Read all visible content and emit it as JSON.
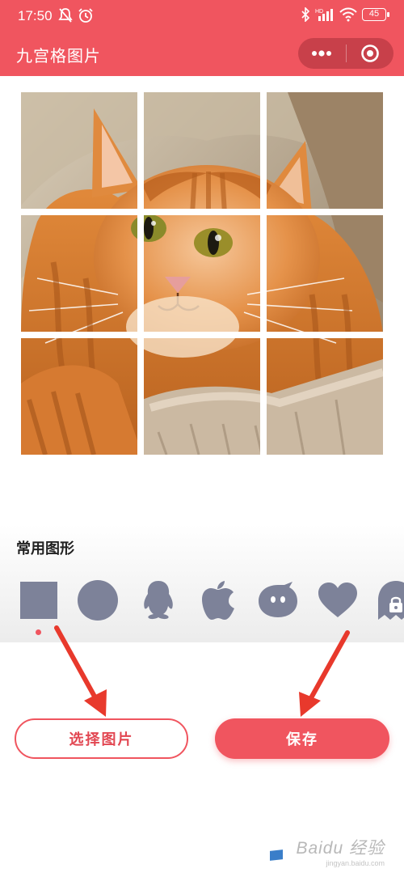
{
  "status_bar": {
    "time": "17:50",
    "battery": "45",
    "network": "HD"
  },
  "header": {
    "title": "九宫格图片",
    "more_icon": "more-dots-icon",
    "close_icon": "target-circle-icon"
  },
  "image": {
    "subject": "orange-tabby-cat",
    "rows": 3,
    "cols": 3
  },
  "shapes": {
    "title": "常用图形",
    "selected_index": 0,
    "items": [
      {
        "name": "square",
        "icon": "square-icon",
        "locked": false
      },
      {
        "name": "circle",
        "icon": "circle-icon",
        "locked": false
      },
      {
        "name": "qq-penguin",
        "icon": "qq-penguin-icon",
        "locked": false
      },
      {
        "name": "apple",
        "icon": "apple-icon",
        "locked": false
      },
      {
        "name": "chat-bubble",
        "icon": "chat-bubble-icon",
        "locked": false
      },
      {
        "name": "heart",
        "icon": "heart-icon",
        "locked": false
      },
      {
        "name": "ghost",
        "icon": "ghost-icon",
        "locked": true
      }
    ],
    "color": "#7d8299"
  },
  "actions": {
    "select_label": "选择图片",
    "save_label": "保存"
  },
  "colors": {
    "accent": "#f0555f",
    "annotation_arrow": "#e8392c"
  },
  "watermark": {
    "text": "Baidu 经验",
    "sub": "jingyan.baidu.com"
  }
}
